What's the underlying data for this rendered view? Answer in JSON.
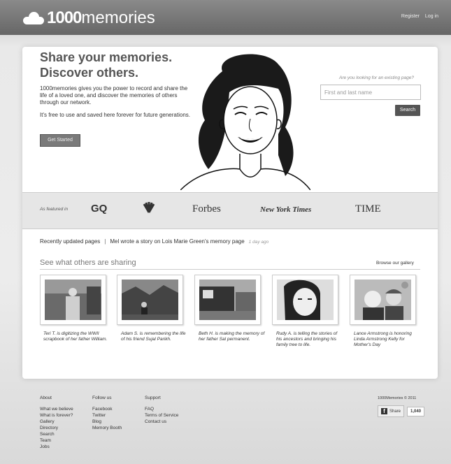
{
  "brand": {
    "logo_bold": "1000",
    "logo_light": "memories"
  },
  "topnav": {
    "register": "Register",
    "login": "Log in"
  },
  "hero": {
    "headline_1": "Share your memories.",
    "headline_2": "Discover others.",
    "para_1": "1000memories gives you the power to record and share the life of a loved one, and discover the memories of others through our network.",
    "para_2": "It's free to use and saved here forever for future generations.",
    "cta": "Get Started"
  },
  "search": {
    "question": "Are you looking for an existing page?",
    "placeholder": "First and last name",
    "button": "Search"
  },
  "featured": {
    "label": "As featured in",
    "outlets": [
      "GQ",
      "NBC",
      "Forbes",
      "New York Times",
      "TIME"
    ]
  },
  "recent": {
    "label": "Recently updated pages",
    "sep": "|",
    "pre": "Mel wrote a story on",
    "name": "Lois Marie Green",
    "post": "'s memory page",
    "time": "1 day ago"
  },
  "gallery": {
    "title": "See what others are sharing",
    "browse": "Browse our gallery",
    "items": [
      {
        "caption": "Teri T. is digitizing the WWII scrapbook of her father William."
      },
      {
        "caption": "Adam S. is remembering the life of his friend Sujal Parikh."
      },
      {
        "caption": "Beth H. is making the memory of her father Sal permanent."
      },
      {
        "caption": "Rudy A. is telling the stories of his ancestors and bringing his family tree to life."
      },
      {
        "caption": "Lance Armstrong is honoring Linda Armstrong Kelly for Mother's Day"
      }
    ]
  },
  "footer": {
    "about": {
      "heading": "About",
      "links": [
        "What we believe",
        "What is forever?",
        "Gallery",
        "Directory",
        "Search",
        "Team",
        "Jobs"
      ]
    },
    "follow": {
      "heading": "Follow us",
      "links": [
        "Facebook",
        "Twitter",
        "Blog",
        "Memory Booth"
      ]
    },
    "support": {
      "heading": "Support",
      "links": [
        "FAQ",
        "Terms of Service",
        "Contact us"
      ]
    },
    "copyright": "1000Memories © 2011",
    "share_label": "Share",
    "share_count": "1,040"
  }
}
